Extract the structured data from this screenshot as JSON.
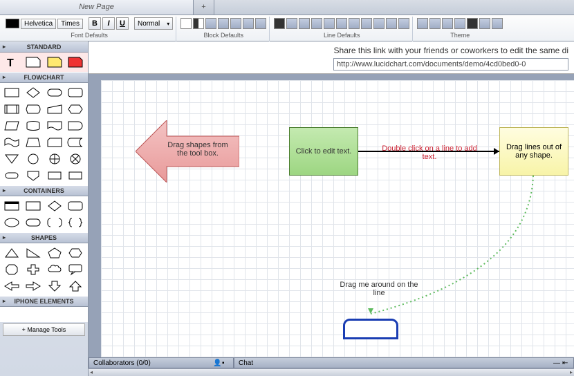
{
  "tabs": {
    "page1": "New Page",
    "add": "+"
  },
  "toolbar": {
    "fonts": [
      "Helvetica",
      "Times"
    ],
    "bold": "B",
    "italic": "I",
    "underline": "U",
    "size": "Normal",
    "font_defaults": "Font Defaults",
    "block_defaults": "Block Defaults",
    "line_defaults": "Line Defaults",
    "theme": "Theme"
  },
  "sidebar": {
    "categories": [
      "STANDARD",
      "FLOWCHART",
      "CONTAINERS",
      "SHAPES",
      "IPHONE ELEMENTS"
    ],
    "manage": "+ Manage Tools"
  },
  "share": {
    "text": "Share this link with your friends or coworkers to edit the same di",
    "url": "http://www.lucidchart.com/documents/demo/4cd0bed0-0"
  },
  "canvas": {
    "arrow_text": "Drag shapes from the tool box.",
    "green_text": "Click to edit text.",
    "yellow_text": "Drag lines out of any shape.",
    "line_label": "Double click on a line to add text.",
    "drag_label": "Drag me around on the line"
  },
  "panels": {
    "collab": "Collaborators (0/0)",
    "chat": "Chat"
  }
}
